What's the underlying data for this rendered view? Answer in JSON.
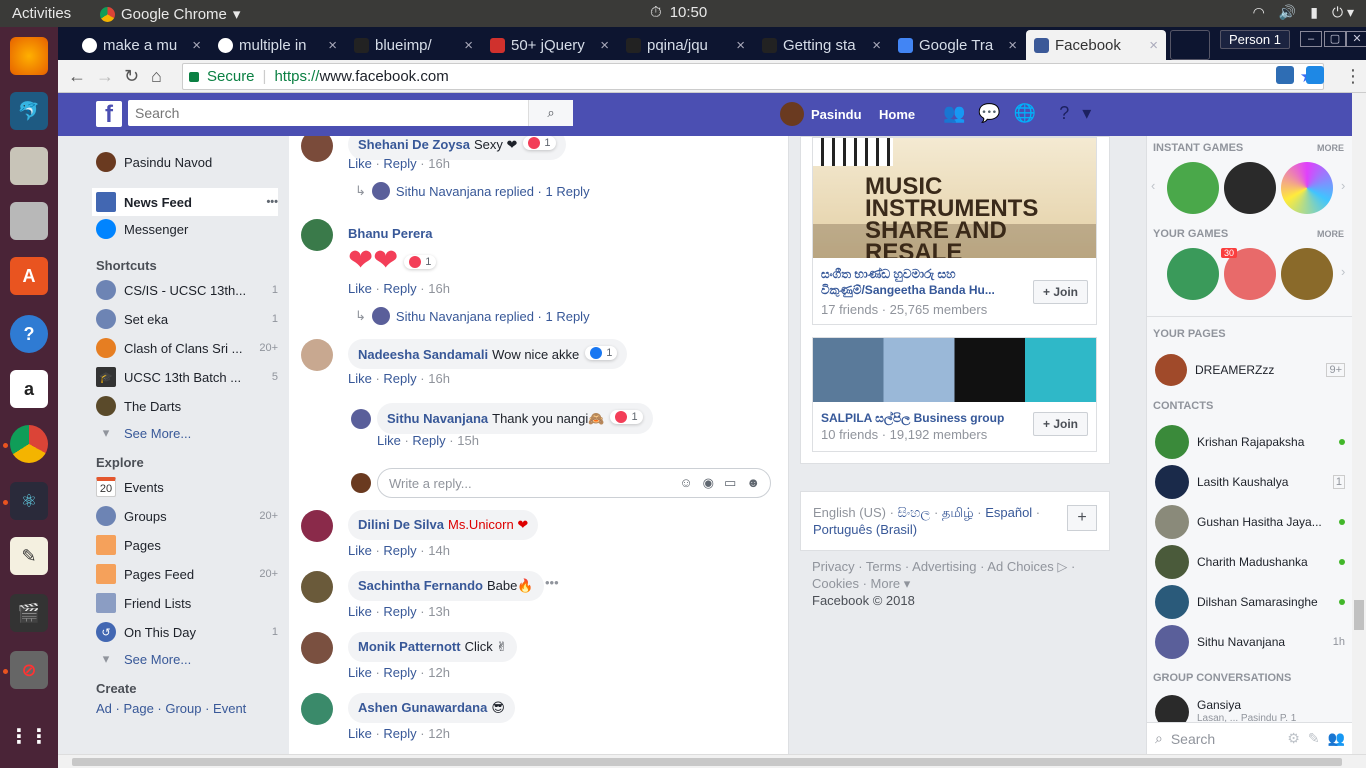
{
  "os": {
    "activities": "Activities",
    "app_name": "Google Chrome",
    "clock": "10:50"
  },
  "browser": {
    "tabs": [
      {
        "label": "make a mu",
        "color": "#4285f4"
      },
      {
        "label": "multiple in",
        "color": "#4285f4"
      },
      {
        "label": "blueimp/",
        "color": "#333333"
      },
      {
        "label": "50+ jQuery",
        "color": "#d0312d"
      },
      {
        "label": "pqina/jqu",
        "color": "#333333"
      },
      {
        "label": "Getting sta",
        "color": "#333333"
      },
      {
        "label": "Google Tra",
        "color": "#4285f4"
      },
      {
        "label": "Facebook",
        "color": "#3b5998"
      }
    ],
    "close_glyph": "×",
    "person": "Person 1",
    "secure": "Secure",
    "url_scheme": "https://",
    "url_rest": "www.facebook.com"
  },
  "fb": {
    "search_placeholder": "Search",
    "user": "Pasindu",
    "home": "Home",
    "left": {
      "profile": "Pasindu Navod",
      "news_feed": "News Feed",
      "news_more": "•••",
      "messenger": "Messenger",
      "shortcuts_title": "Shortcuts",
      "shortcuts": [
        {
          "label": "CS/IS - UCSC 13th...",
          "count": "1"
        },
        {
          "label": "Set eka",
          "count": "1"
        },
        {
          "label": "Clash of Clans Sri ...",
          "count": "20+"
        },
        {
          "label": "UCSC 13th Batch ...",
          "count": "5"
        },
        {
          "label": "The Darts",
          "count": ""
        }
      ],
      "see_more": "See More...",
      "explore_title": "Explore",
      "events_day": "20",
      "explore": [
        {
          "label": "Events",
          "count": ""
        },
        {
          "label": "Groups",
          "count": "20+"
        },
        {
          "label": "Pages",
          "count": ""
        },
        {
          "label": "Pages Feed",
          "count": "20+"
        },
        {
          "label": "Friend Lists",
          "count": ""
        },
        {
          "label": "On This Day",
          "count": "1"
        }
      ],
      "see_more2": "See More...",
      "create_title": "Create",
      "create_links": "Ad · Page · Group · Event"
    },
    "comments": [
      {
        "name": "Shehani De Zoysa",
        "text": "Sexy ❤",
        "react": "1",
        "time": "16h",
        "reply": "Sithu Navanjana replied · 1 Reply"
      },
      {
        "name": "Bhanu Perera",
        "text": "❤❤",
        "react": "1",
        "time": "16h",
        "reply": "Sithu Navanjana replied · 1 Reply"
      },
      {
        "name": "Nadeesha Sandamali",
        "text": "Wow nice akke",
        "react": "1",
        "time": "16h"
      },
      {
        "name": "Sithu Navanjana",
        "text": "Thank you nangi🙈",
        "react": "1",
        "time": "15h"
      },
      {
        "name": "Dilini De Silva",
        "text": "Ms.Unicorn ❤",
        "time": "14h"
      },
      {
        "name": "Sachintha Fernando",
        "text": "Babe🔥",
        "time": "13h"
      },
      {
        "name": "Monik Patternott",
        "text": "Click ✌",
        "time": "12h"
      },
      {
        "name": "Ashen Gunawardana",
        "text": "😎",
        "time": "12h"
      }
    ],
    "like": "Like",
    "reply": "Reply",
    "write_reply": "Write a reply...",
    "groups": [
      {
        "name": "සංගීත භාණ්ඩ හුවමාරු සහ විකුණුම්/Sangeetha Banda Hu...",
        "sub": "17 friends · 25,765 members",
        "banner": "MUSIC INSTRUMENTS SHARE AND RESALE"
      },
      {
        "name": "SALPILA සල්පිල Business group",
        "sub": "10 friends · 19,192 members"
      }
    ],
    "join": "+ Join",
    "lang_plain": "English (US) · ",
    "lang_links": [
      "සිංහල",
      "தமிழ்",
      "Español",
      "Português (Brasil)"
    ],
    "footer": "Privacy · Terms · Advertising · Ad Choices ▷ · Cookies · More ▾",
    "copyright": "Facebook © 2018",
    "chat": {
      "instant_games": "INSTANT GAMES",
      "your_games": "YOUR GAMES",
      "more": "MORE",
      "game_badge": "30",
      "your_pages": "YOUR PAGES",
      "page": {
        "name": "DREAMERZzz",
        "count": "9+"
      },
      "contacts_title": "CONTACTS",
      "contacts": [
        {
          "name": "Krishan Rajapaksha",
          "status": "online"
        },
        {
          "name": "Lasith Kaushalya",
          "status": "1"
        },
        {
          "name": "Gushan Hasitha Jaya...",
          "status": "online"
        },
        {
          "name": "Charith Madushanka",
          "status": "online"
        },
        {
          "name": "Dilshan Samarasinghe",
          "status": "online"
        },
        {
          "name": "Sithu Navanjana",
          "status": "1h"
        }
      ],
      "group_conv": "GROUP CONVERSATIONS",
      "gconv": {
        "name": "Gansiya",
        "sub": "Lasan, ... Pasindu P. 1"
      },
      "search": "Search"
    }
  }
}
